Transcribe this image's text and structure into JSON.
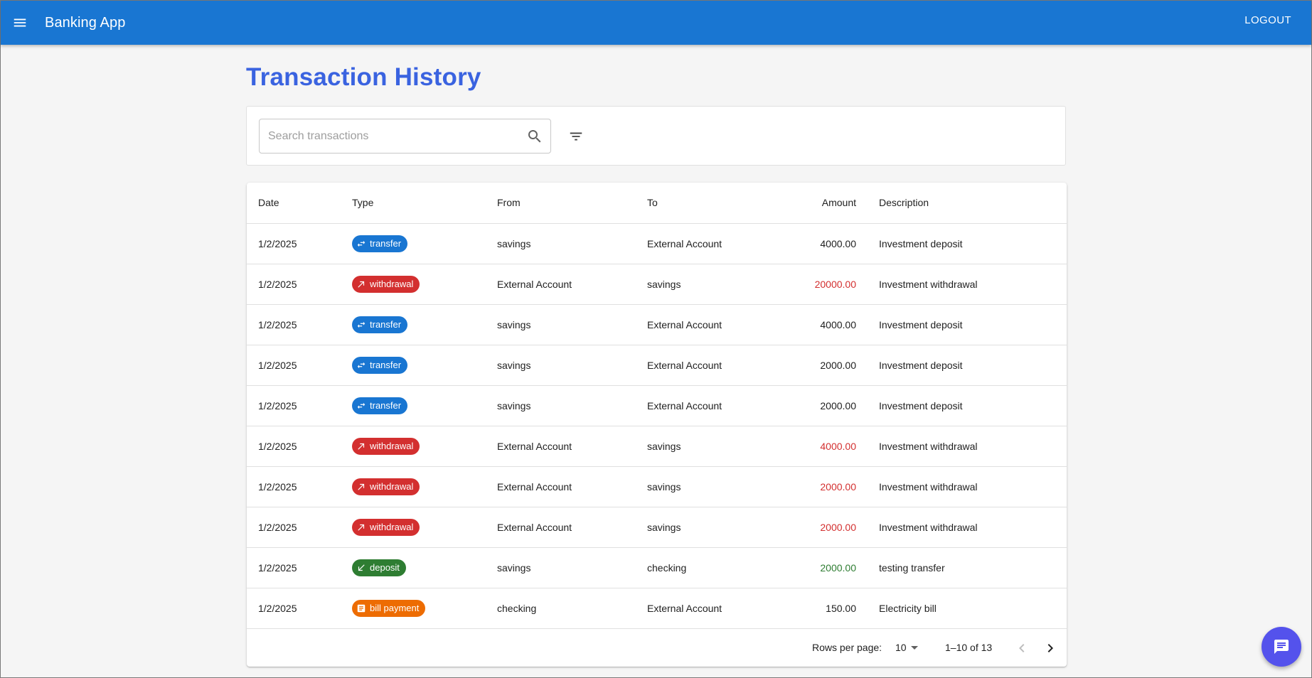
{
  "app": {
    "title": "Banking App",
    "logout_label": "LOGOUT",
    "menu_icon": "menu-icon"
  },
  "page": {
    "title": "Transaction History"
  },
  "search": {
    "placeholder": "Search transactions",
    "value": "",
    "search_icon": "search-icon",
    "filter_icon": "filter-icon"
  },
  "table": {
    "columns": [
      "Date",
      "Type",
      "From",
      "To",
      "Amount",
      "Description"
    ],
    "rows": [
      {
        "date": "1/2/2025",
        "type": "transfer",
        "from": "savings",
        "to": "External Account",
        "amount": "4000.00",
        "amount_style": "neutral",
        "description": "Investment deposit"
      },
      {
        "date": "1/2/2025",
        "type": "withdrawal",
        "from": "External Account",
        "to": "savings",
        "amount": "20000.00",
        "amount_style": "red",
        "description": "Investment withdrawal"
      },
      {
        "date": "1/2/2025",
        "type": "transfer",
        "from": "savings",
        "to": "External Account",
        "amount": "4000.00",
        "amount_style": "neutral",
        "description": "Investment deposit"
      },
      {
        "date": "1/2/2025",
        "type": "transfer",
        "from": "savings",
        "to": "External Account",
        "amount": "2000.00",
        "amount_style": "neutral",
        "description": "Investment deposit"
      },
      {
        "date": "1/2/2025",
        "type": "transfer",
        "from": "savings",
        "to": "External Account",
        "amount": "2000.00",
        "amount_style": "neutral",
        "description": "Investment deposit"
      },
      {
        "date": "1/2/2025",
        "type": "withdrawal",
        "from": "External Account",
        "to": "savings",
        "amount": "4000.00",
        "amount_style": "red",
        "description": "Investment withdrawal"
      },
      {
        "date": "1/2/2025",
        "type": "withdrawal",
        "from": "External Account",
        "to": "savings",
        "amount": "2000.00",
        "amount_style": "red",
        "description": "Investment withdrawal"
      },
      {
        "date": "1/2/2025",
        "type": "withdrawal",
        "from": "External Account",
        "to": "savings",
        "amount": "2000.00",
        "amount_style": "red",
        "description": "Investment withdrawal"
      },
      {
        "date": "1/2/2025",
        "type": "deposit",
        "from": "savings",
        "to": "checking",
        "amount": "2000.00",
        "amount_style": "green",
        "description": "testing transfer"
      },
      {
        "date": "1/2/2025",
        "type": "bill payment",
        "from": "checking",
        "to": "External Account",
        "amount": "150.00",
        "amount_style": "neutral",
        "description": "Electricity bill"
      }
    ]
  },
  "pagination": {
    "rows_per_page_label": "Rows per page:",
    "rows_per_page": "10",
    "range": "1–10 of 13",
    "prev_icon": "chevron-left-icon",
    "next_icon": "chevron-right-icon"
  },
  "fab": {
    "icon": "chat-icon"
  },
  "colors": {
    "appbar": "#1976d2",
    "title": "#3a63e0",
    "transfer": "#1976d2",
    "withdrawal": "#d32f2f",
    "deposit": "#2e7d32",
    "bill_payment": "#ed6c02",
    "fab": "#5452ec"
  }
}
